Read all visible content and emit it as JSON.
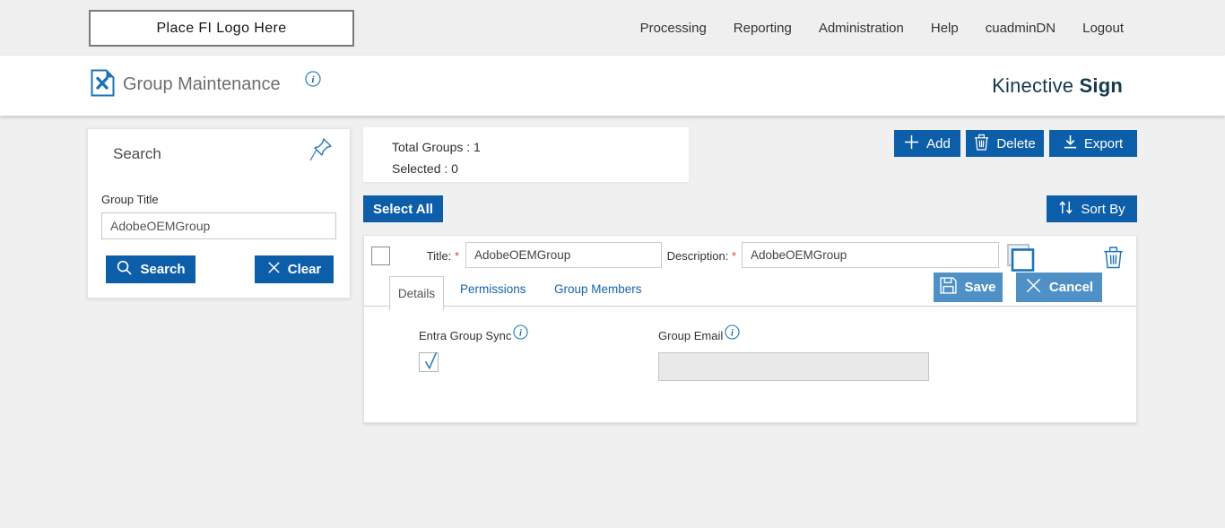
{
  "topbar": {
    "logo_placeholder": "Place FI Logo Here",
    "nav": [
      "Processing",
      "Reporting",
      "Administration",
      "Help",
      "cuadminDN",
      "Logout"
    ]
  },
  "header": {
    "title": "Group Maintenance",
    "brand": {
      "regular": "Kinective",
      "bold": "Sign"
    }
  },
  "search_panel": {
    "title": "Search",
    "group_title_label": "Group Title",
    "group_title_value": "AdobeOEMGroup",
    "search_button": "Search",
    "clear_button": "Clear"
  },
  "summary": {
    "total_groups": "Total Groups : 1",
    "selected": "Selected : 0"
  },
  "toolbar": {
    "add": "Add",
    "delete": "Delete",
    "export": "Export",
    "select_all": "Select All",
    "sort_by": "Sort By"
  },
  "group_row": {
    "title_label": "Title:",
    "description_label": "Description:",
    "required_marker": "*",
    "title_value": "AdobeOEMGroup",
    "description_value": "AdobeOEMGroup",
    "tabs": [
      "Details",
      "Permissions",
      "Group Members"
    ],
    "save": "Save",
    "cancel": "Cancel",
    "details_tab": {
      "entra_group_sync_label": "Entra Group Sync",
      "entra_group_sync_checked": true,
      "group_email_label": "Group Email",
      "group_email_value": ""
    }
  },
  "colors": {
    "primary_blue": "#0d5ea8",
    "secondary_blue": "#4f91c7",
    "link_blue": "#1464a8",
    "icon_blue": "#1e73b5",
    "topbar_bg": "#f0eff0",
    "page_bg": "#f0f0f0",
    "brand_dark": "#15394d",
    "title_gray": "#6d6e71",
    "required_red": "#e03e3e"
  }
}
